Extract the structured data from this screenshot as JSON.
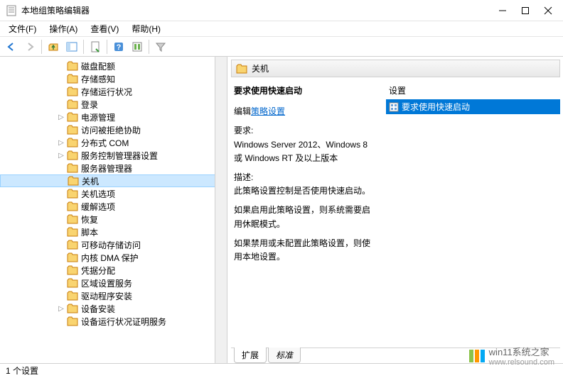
{
  "window": {
    "title": "本地组策略编辑器"
  },
  "menu": {
    "file": "文件(F)",
    "action": "操作(A)",
    "view": "查看(V)",
    "help": "帮助(H)"
  },
  "tree": {
    "items": [
      {
        "label": "磁盘配额",
        "indent": 2,
        "expander": ""
      },
      {
        "label": "存储感知",
        "indent": 2,
        "expander": ""
      },
      {
        "label": "存储运行状况",
        "indent": 2,
        "expander": ""
      },
      {
        "label": "登录",
        "indent": 2,
        "expander": ""
      },
      {
        "label": "电源管理",
        "indent": 2,
        "expander": "▷"
      },
      {
        "label": "访问被拒绝协助",
        "indent": 2,
        "expander": ""
      },
      {
        "label": "分布式 COM",
        "indent": 2,
        "expander": "▷"
      },
      {
        "label": "服务控制管理器设置",
        "indent": 2,
        "expander": "▷"
      },
      {
        "label": "服务器管理器",
        "indent": 2,
        "expander": ""
      },
      {
        "label": "关机",
        "indent": 2,
        "expander": "",
        "selected": true
      },
      {
        "label": "关机选项",
        "indent": 2,
        "expander": ""
      },
      {
        "label": "缓解选项",
        "indent": 2,
        "expander": ""
      },
      {
        "label": "恢复",
        "indent": 2,
        "expander": ""
      },
      {
        "label": "脚本",
        "indent": 2,
        "expander": ""
      },
      {
        "label": "可移动存储访问",
        "indent": 2,
        "expander": ""
      },
      {
        "label": "内核 DMA 保护",
        "indent": 2,
        "expander": ""
      },
      {
        "label": "凭据分配",
        "indent": 2,
        "expander": ""
      },
      {
        "label": "区域设置服务",
        "indent": 2,
        "expander": ""
      },
      {
        "label": "驱动程序安装",
        "indent": 2,
        "expander": ""
      },
      {
        "label": "设备安装",
        "indent": 2,
        "expander": "▷"
      },
      {
        "label": "设备运行状况证明服务",
        "indent": 2,
        "expander": ""
      }
    ]
  },
  "detail": {
    "header": "关机",
    "policyTitle": "要求使用快速启动",
    "editPrefix": "编辑",
    "editLink": "策略设置",
    "reqLabel": "要求:",
    "reqText": "Windows Server 2012、Windows 8 或 Windows RT 及以上版本",
    "descLabel": "描述:",
    "descText": "此策略设置控制是否使用快速启动。",
    "para1": "如果启用此策略设置，则系统需要启用休眠模式。",
    "para2": "如果禁用或未配置此策略设置，则使用本地设置。",
    "settingsHeader": "设置",
    "settingRow": "要求使用快速启动"
  },
  "tabs": {
    "extended": "扩展",
    "standard": "标准"
  },
  "statusbar": "1 个设置",
  "watermark": {
    "line1": "win11系统之家",
    "line2": "www.relsound.com"
  }
}
